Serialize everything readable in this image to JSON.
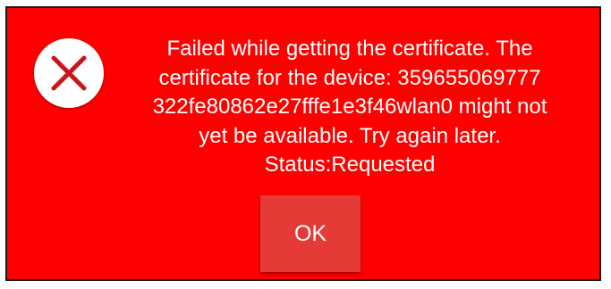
{
  "dialog": {
    "icon": "error-x-icon",
    "message_lines": [
      "Failed while getting the certificate. The",
      "certificate for the device: 359655069777",
      "322fe80862e27fffe1e3f46wlan0 might not",
      "yet be available. Try again later.",
      "Status:Requested"
    ],
    "ok_label": "OK"
  },
  "colors": {
    "background": "#ff0000",
    "button": "#e63a36",
    "icon_x": "#c9161b",
    "text": "#ffffff"
  }
}
